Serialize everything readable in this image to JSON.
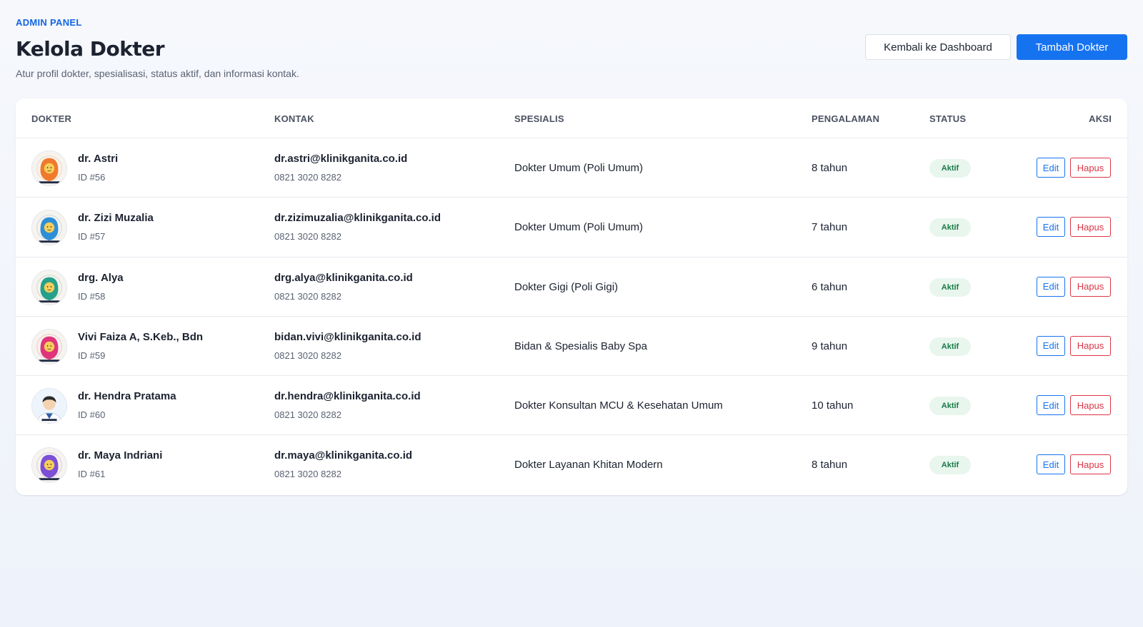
{
  "header": {
    "eyebrow": "ADMIN PANEL",
    "title": "Kelola Dokter",
    "subtitle": "Atur profil dokter, spesialisasi, status aktif, dan informasi kontak.",
    "back_button": "Kembali ke Dashboard",
    "add_button": "Tambah Dokter"
  },
  "table": {
    "columns": {
      "doctor": "DOKTER",
      "contact": "KONTAK",
      "specialist": "SPESIALIS",
      "experience": "PENGALAMAN",
      "status": "STATUS",
      "actions": "AKSI"
    },
    "edit_label": "Edit",
    "delete_label": "Hapus",
    "rows": [
      {
        "name": "dr. Astri",
        "id": "ID #56",
        "email": "dr.astri@klinikganita.co.id",
        "phone": "0821 3020 8282",
        "specialist": "Dokter Umum (Poli Umum)",
        "experience": "8 tahun",
        "status": "Aktif",
        "avatar_color": "#f07a2c"
      },
      {
        "name": "dr. Zizi Muzalia",
        "id": "ID #57",
        "email": "dr.zizimuzalia@klinikganita.co.id",
        "phone": "0821 3020 8282",
        "specialist": "Dokter Umum (Poli Umum)",
        "experience": "7 tahun",
        "status": "Aktif",
        "avatar_color": "#2f8fd6"
      },
      {
        "name": "drg. Alya",
        "id": "ID #58",
        "email": "drg.alya@klinikganita.co.id",
        "phone": "0821 3020 8282",
        "specialist": "Dokter Gigi (Poli Gigi)",
        "experience": "6 tahun",
        "status": "Aktif",
        "avatar_color": "#27a08a"
      },
      {
        "name": "Vivi Faiza A, S.Keb., Bdn",
        "id": "ID #59",
        "email": "bidan.vivi@klinikganita.co.id",
        "phone": "0821 3020 8282",
        "specialist": "Bidan & Spesialis Baby Spa",
        "experience": "9 tahun",
        "status": "Aktif",
        "avatar_color": "#e0357a"
      },
      {
        "name": "dr. Hendra Pratama",
        "id": "ID #60",
        "email": "dr.hendra@klinikganita.co.id",
        "phone": "0821 3020 8282",
        "specialist": "Dokter Konsultan MCU & Kesehatan Umum",
        "experience": "10 tahun",
        "status": "Aktif",
        "avatar_color": "#e9f1fb"
      },
      {
        "name": "dr. Maya Indriani",
        "id": "ID #61",
        "email": "dr.maya@klinikganita.co.id",
        "phone": "0821 3020 8282",
        "specialist": "Dokter Layanan Khitan Modern",
        "experience": "8 tahun",
        "status": "Aktif",
        "avatar_color": "#7b4fd6"
      }
    ]
  }
}
